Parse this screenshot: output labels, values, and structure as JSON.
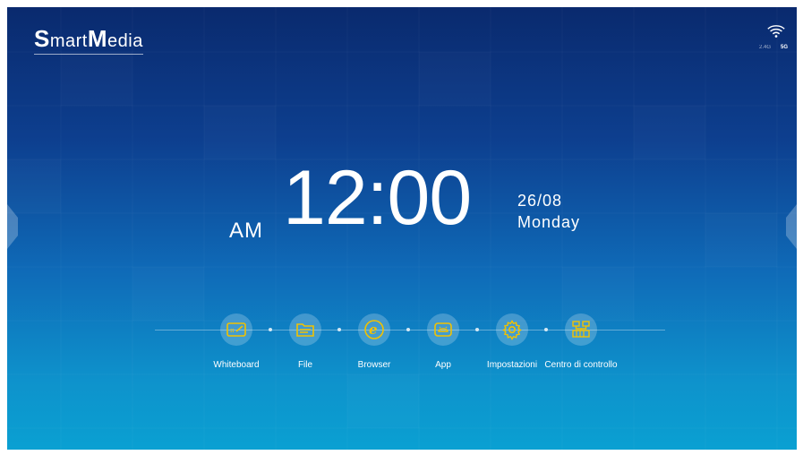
{
  "brand": {
    "logo_text_s": "S",
    "logo_text_mart": "mart",
    "logo_text_m": "M",
    "logo_text_edia": "edia"
  },
  "status": {
    "wifi_24": "2.4G",
    "wifi_5": "5G",
    "wifi_icon": "wifi-icon"
  },
  "clock": {
    "ampm": "AM",
    "time": "12:00",
    "date": "26/08",
    "day": "Monday"
  },
  "dock": {
    "apps": [
      {
        "label": "Whiteboard",
        "icon": "whiteboard-icon"
      },
      {
        "label": "File",
        "icon": "folder-icon"
      },
      {
        "label": "Browser",
        "icon": "browser-e-icon"
      },
      {
        "label": "App",
        "icon": "android-app-icon"
      },
      {
        "label": "Impostazioni",
        "icon": "gear-icon"
      },
      {
        "label": "Centro di controllo",
        "icon": "control-center-icon"
      }
    ]
  },
  "colors": {
    "accent": "#f2c200",
    "icon_bg": "rgba(255,255,255,0.22)"
  }
}
